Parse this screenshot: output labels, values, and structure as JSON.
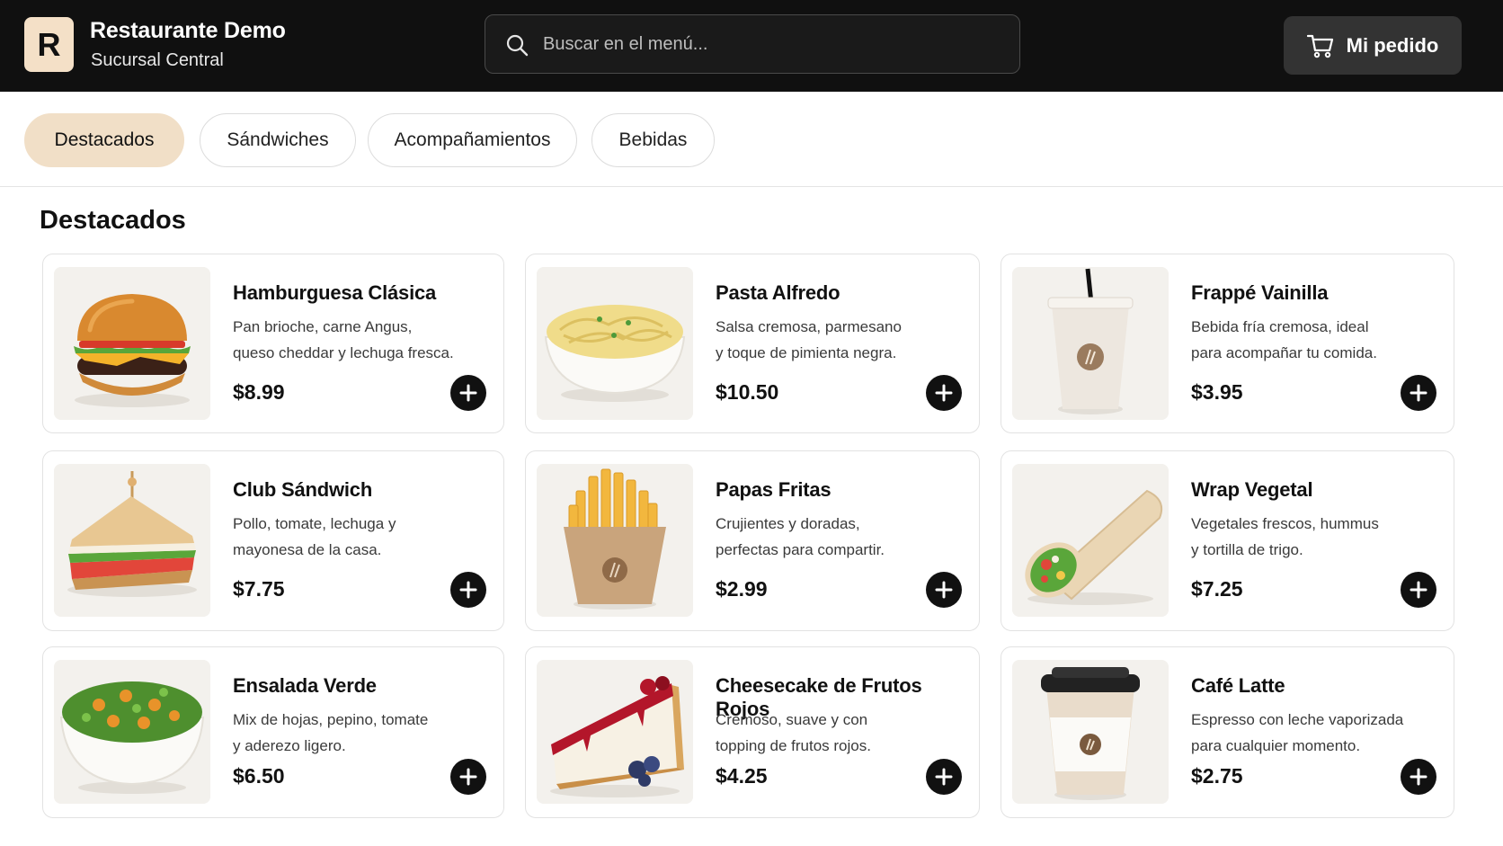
{
  "header": {
    "logo_letter": "R",
    "restaurant_name": "Restaurante Demo",
    "branch": "Sucursal Central",
    "search_placeholder": "Buscar en el menú...",
    "cart_label": "Mi pedido",
    "icons": {
      "search": "search-icon",
      "cart": "cart-icon"
    }
  },
  "tabs": [
    {
      "label": "Destacados",
      "active": true
    },
    {
      "label": "Sándwiches",
      "active": false
    },
    {
      "label": "Acompañamientos",
      "active": false
    },
    {
      "label": "Bebidas",
      "active": false
    }
  ],
  "section": {
    "title": "Destacados"
  },
  "items": [
    {
      "name": "Hamburguesa Clásica",
      "desc_1": "Pan brioche, carne Angus,",
      "desc_2": "queso cheddar y lechuga fresca.",
      "price": "$8.99",
      "image": "burger"
    },
    {
      "name": "Pasta Alfredo",
      "desc_1": "Salsa cremosa, parmesano",
      "desc_2": "y toque de pimienta negra.",
      "price": "$10.50",
      "image": "pasta"
    },
    {
      "name": "Frappé Vainilla",
      "desc_1": "Bebida fría cremosa, ideal",
      "desc_2": "para acompañar tu comida.",
      "price": "$3.95",
      "image": "frappe"
    },
    {
      "name": "Club Sándwich",
      "desc_1": "Pollo, tomate, lechuga y",
      "desc_2": "mayonesa de la casa.",
      "price": "$7.75",
      "image": "sandwich"
    },
    {
      "name": "Papas Fritas",
      "desc_1": "Crujientes y doradas,",
      "desc_2": "perfectas para compartir.",
      "price": "$2.99",
      "image": "fries"
    },
    {
      "name": "Wrap Vegetal",
      "desc_1": "Vegetales frescos, hummus",
      "desc_2": "y tortilla de trigo.",
      "price": "$7.25",
      "image": "wrap"
    },
    {
      "name": "Ensalada Verde",
      "desc_1": "Mix de hojas, pepino, tomate",
      "desc_2": "y aderezo ligero.",
      "price": "$6.50",
      "image": "salad"
    },
    {
      "name": "Cheesecake de Frutos Rojos",
      "desc_1": "Cremoso, suave y con",
      "desc_2": "topping de frutos rojos.",
      "price": "$4.25",
      "image": "cheesecake"
    },
    {
      "name": "Café Latte",
      "desc_1": "Espresso con leche vaporizada",
      "desc_2": "para cualquier momento.",
      "price": "$2.75",
      "image": "latte"
    }
  ],
  "add_icon": "plus-icon",
  "colors": {
    "header_bg": "#101010",
    "accent_tab": "#f1dfc7",
    "logo_bg": "#f4e0c7",
    "cart_button_bg": "#333333",
    "add_button_bg": "#111111"
  }
}
